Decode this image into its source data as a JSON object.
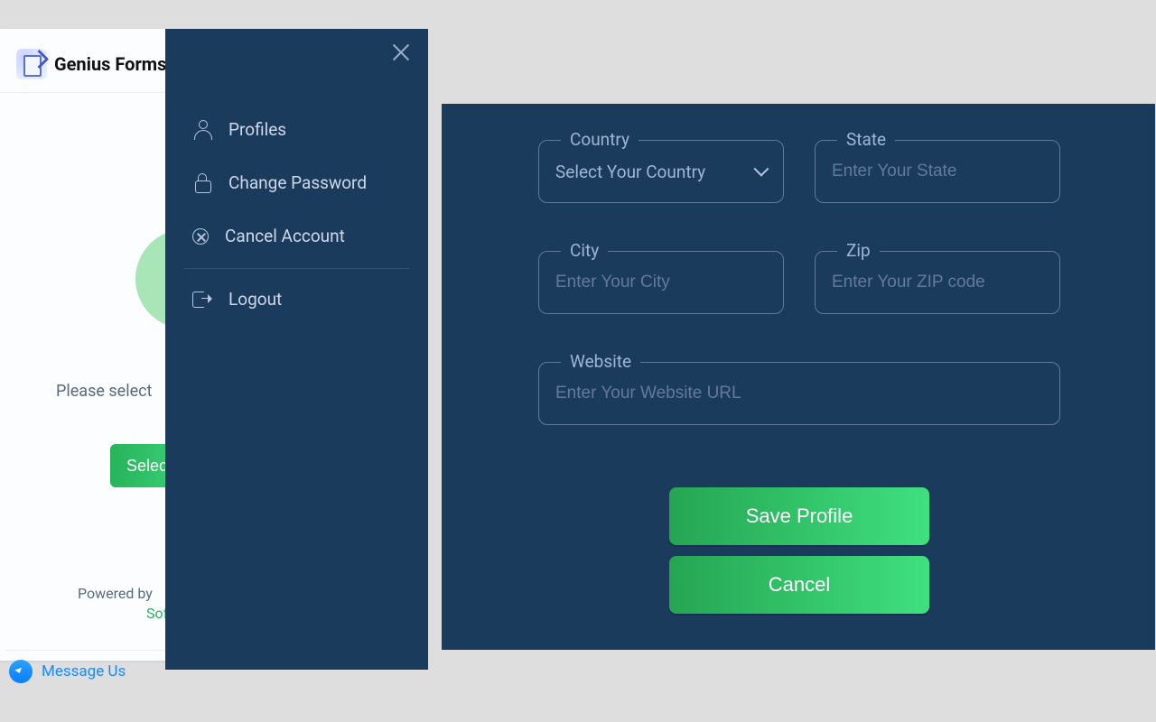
{
  "left": {
    "title": "Genius Forms",
    "prompt": "Please select",
    "select_button": "Select",
    "powered_prefix": "Powered by",
    "powered_suffix": "Sof",
    "message_us": "Message Us"
  },
  "drawer": {
    "items": [
      {
        "label": "Profiles"
      },
      {
        "label": "Change Password"
      },
      {
        "label": "Cancel Account"
      },
      {
        "label": "Logout"
      }
    ]
  },
  "form": {
    "country": {
      "label": "Country",
      "selected": "Select Your Country"
    },
    "state": {
      "label": "State",
      "placeholder": "Enter Your State"
    },
    "city": {
      "label": "City",
      "placeholder": "Enter Your City"
    },
    "zip": {
      "label": "Zip",
      "placeholder": "Enter Your ZIP code"
    },
    "website": {
      "label": "Website",
      "placeholder": "Enter Your Website URL"
    },
    "save": "Save Profile",
    "cancel": "Cancel"
  }
}
